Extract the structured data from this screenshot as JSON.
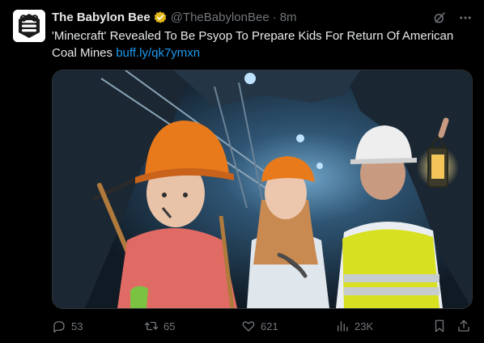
{
  "author": {
    "name": "The Babylon Bee",
    "handle": "@TheBabylonBee",
    "separator": "·",
    "time": "8m",
    "avatar_icon": "bee-logo-icon",
    "verified_icon": "gold-verified-badge-icon"
  },
  "header_actions": {
    "grok_icon": "grok-icon",
    "more_icon": "more-dots-icon"
  },
  "post": {
    "text": "'Minecraft' Revealed To Be Psyop To Prepare Kids For Return Of American Coal Mines",
    "link": "buff.ly/qk7ymxn"
  },
  "media": {
    "description_icon": "coal-mine-children-photo"
  },
  "engagement": {
    "replies": "53",
    "reposts": "65",
    "likes": "621",
    "views": "23K",
    "reply_icon": "reply-icon",
    "repost_icon": "repost-icon",
    "like_icon": "heart-icon",
    "views_icon": "views-chart-icon",
    "bookmark_icon": "bookmark-icon",
    "share_icon": "share-icon"
  },
  "colors": {
    "background": "#000000",
    "text": "#e7e9ea",
    "muted": "#71767b",
    "link": "#1d9bf0",
    "verified_gold": "#e2b719",
    "hardhat_orange": "#e87a1c"
  }
}
